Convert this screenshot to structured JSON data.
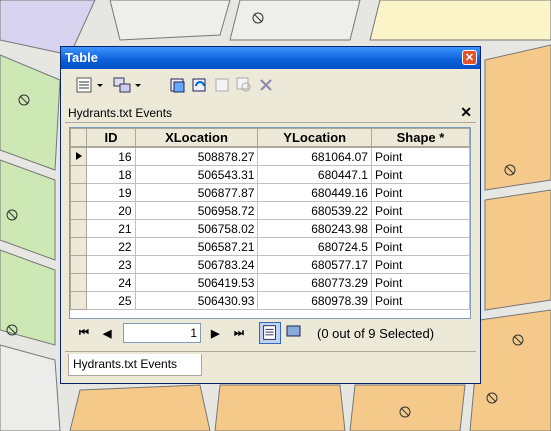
{
  "window": {
    "title": "Table",
    "close": "✕"
  },
  "tab": {
    "label": "Hydrants.txt Events",
    "close": "✕"
  },
  "columns": [
    "ID",
    "XLocation",
    "YLocation",
    "Shape *"
  ],
  "rows": [
    {
      "id": "16",
      "x": "508878.27",
      "y": "681064.07",
      "shape": "Point",
      "current": true
    },
    {
      "id": "18",
      "x": "506543.31",
      "y": "680447.1",
      "shape": "Point"
    },
    {
      "id": "19",
      "x": "506877.87",
      "y": "680449.16",
      "shape": "Point"
    },
    {
      "id": "20",
      "x": "506958.72",
      "y": "680539.22",
      "shape": "Point"
    },
    {
      "id": "21",
      "x": "506758.02",
      "y": "680243.98",
      "shape": "Point"
    },
    {
      "id": "22",
      "x": "506587.21",
      "y": "680724.5",
      "shape": "Point"
    },
    {
      "id": "23",
      "x": "506783.24",
      "y": "680577.17",
      "shape": "Point"
    },
    {
      "id": "24",
      "x": "506419.53",
      "y": "680773.29",
      "shape": "Point"
    },
    {
      "id": "25",
      "x": "506430.93",
      "y": "680978.39",
      "shape": "Point"
    }
  ],
  "nav": {
    "first": "⏮",
    "prev": "◀",
    "record": "1",
    "next": "▶",
    "last": "⏭",
    "status": "(0 out of 9 Selected)"
  },
  "bottom_tab": {
    "label": "Hydrants.txt Events"
  },
  "colors": {
    "title_bar": "#0a5fd8",
    "map_green": "#cde8b4",
    "map_orange": "#f5c98a",
    "map_purple": "#d8d4f0",
    "map_yellow": "#fbf4c8"
  },
  "icons": [
    "table-options-icon",
    "related-tables-icon",
    "select-by-attributes-icon",
    "switch-selection-icon",
    "clear-selection-icon",
    "zoom-to-selected-icon",
    "delete-selected-icon"
  ]
}
